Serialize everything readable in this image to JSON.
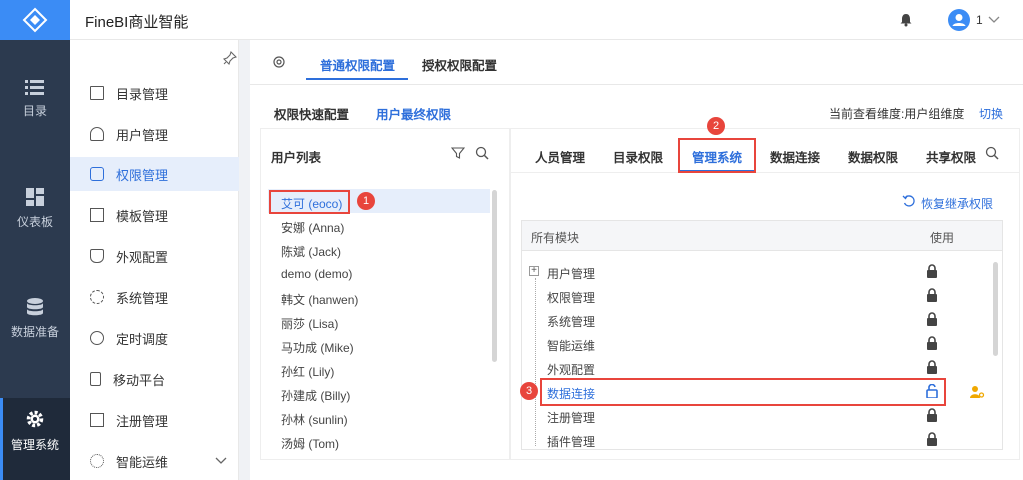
{
  "app": {
    "title": "FineBI商业智能",
    "user_label": "1"
  },
  "leftnav": [
    {
      "label": "目录",
      "icon": "list-icon"
    },
    {
      "label": "仪表板",
      "icon": "dashboard-icon"
    },
    {
      "label": "数据准备",
      "icon": "database-icon"
    },
    {
      "label": "管理系统",
      "icon": "gear-icon",
      "active": true
    }
  ],
  "menu": [
    {
      "label": "目录管理"
    },
    {
      "label": "用户管理"
    },
    {
      "label": "权限管理",
      "active": true
    },
    {
      "label": "模板管理"
    },
    {
      "label": "外观配置"
    },
    {
      "label": "系统管理"
    },
    {
      "label": "定时调度"
    },
    {
      "label": "移动平台"
    },
    {
      "label": "注册管理"
    },
    {
      "label": "智能运维"
    }
  ],
  "tabs_top": [
    "普通权限配置",
    "授权权限配置"
  ],
  "tabs_sub": [
    "权限快速配置",
    "用户最终权限"
  ],
  "dimension": {
    "text": "当前查看维度:用户组维度",
    "switch": "切换"
  },
  "user_list": {
    "title": "用户列表",
    "users": [
      "艾可 (eoco)",
      "安娜 (Anna)",
      "陈斌 (Jack)",
      "demo (demo)",
      "韩文 (hanwen)",
      "丽莎 (Lisa)",
      "马功成 (Mike)",
      "孙红 (Lily)",
      "孙建成 (Billy)",
      "孙林 (sunlin)",
      "汤姆 (Tom)"
    ]
  },
  "perm_tabs": [
    "人员管理",
    "目录权限",
    "管理系统",
    "数据连接",
    "数据权限",
    "共享权限"
  ],
  "restore": "恢复继承权限",
  "table": {
    "col_modules": "所有模块",
    "col_use": "使用",
    "rows": [
      "用户管理",
      "权限管理",
      "系统管理",
      "智能运维",
      "外观配置",
      "数据连接",
      "注册管理",
      "插件管理"
    ]
  },
  "badges": [
    "1",
    "2",
    "3"
  ],
  "colors": {
    "accent": "#2e6fdb",
    "highlight": "#e8453c",
    "nav": "#2c3a4f"
  }
}
